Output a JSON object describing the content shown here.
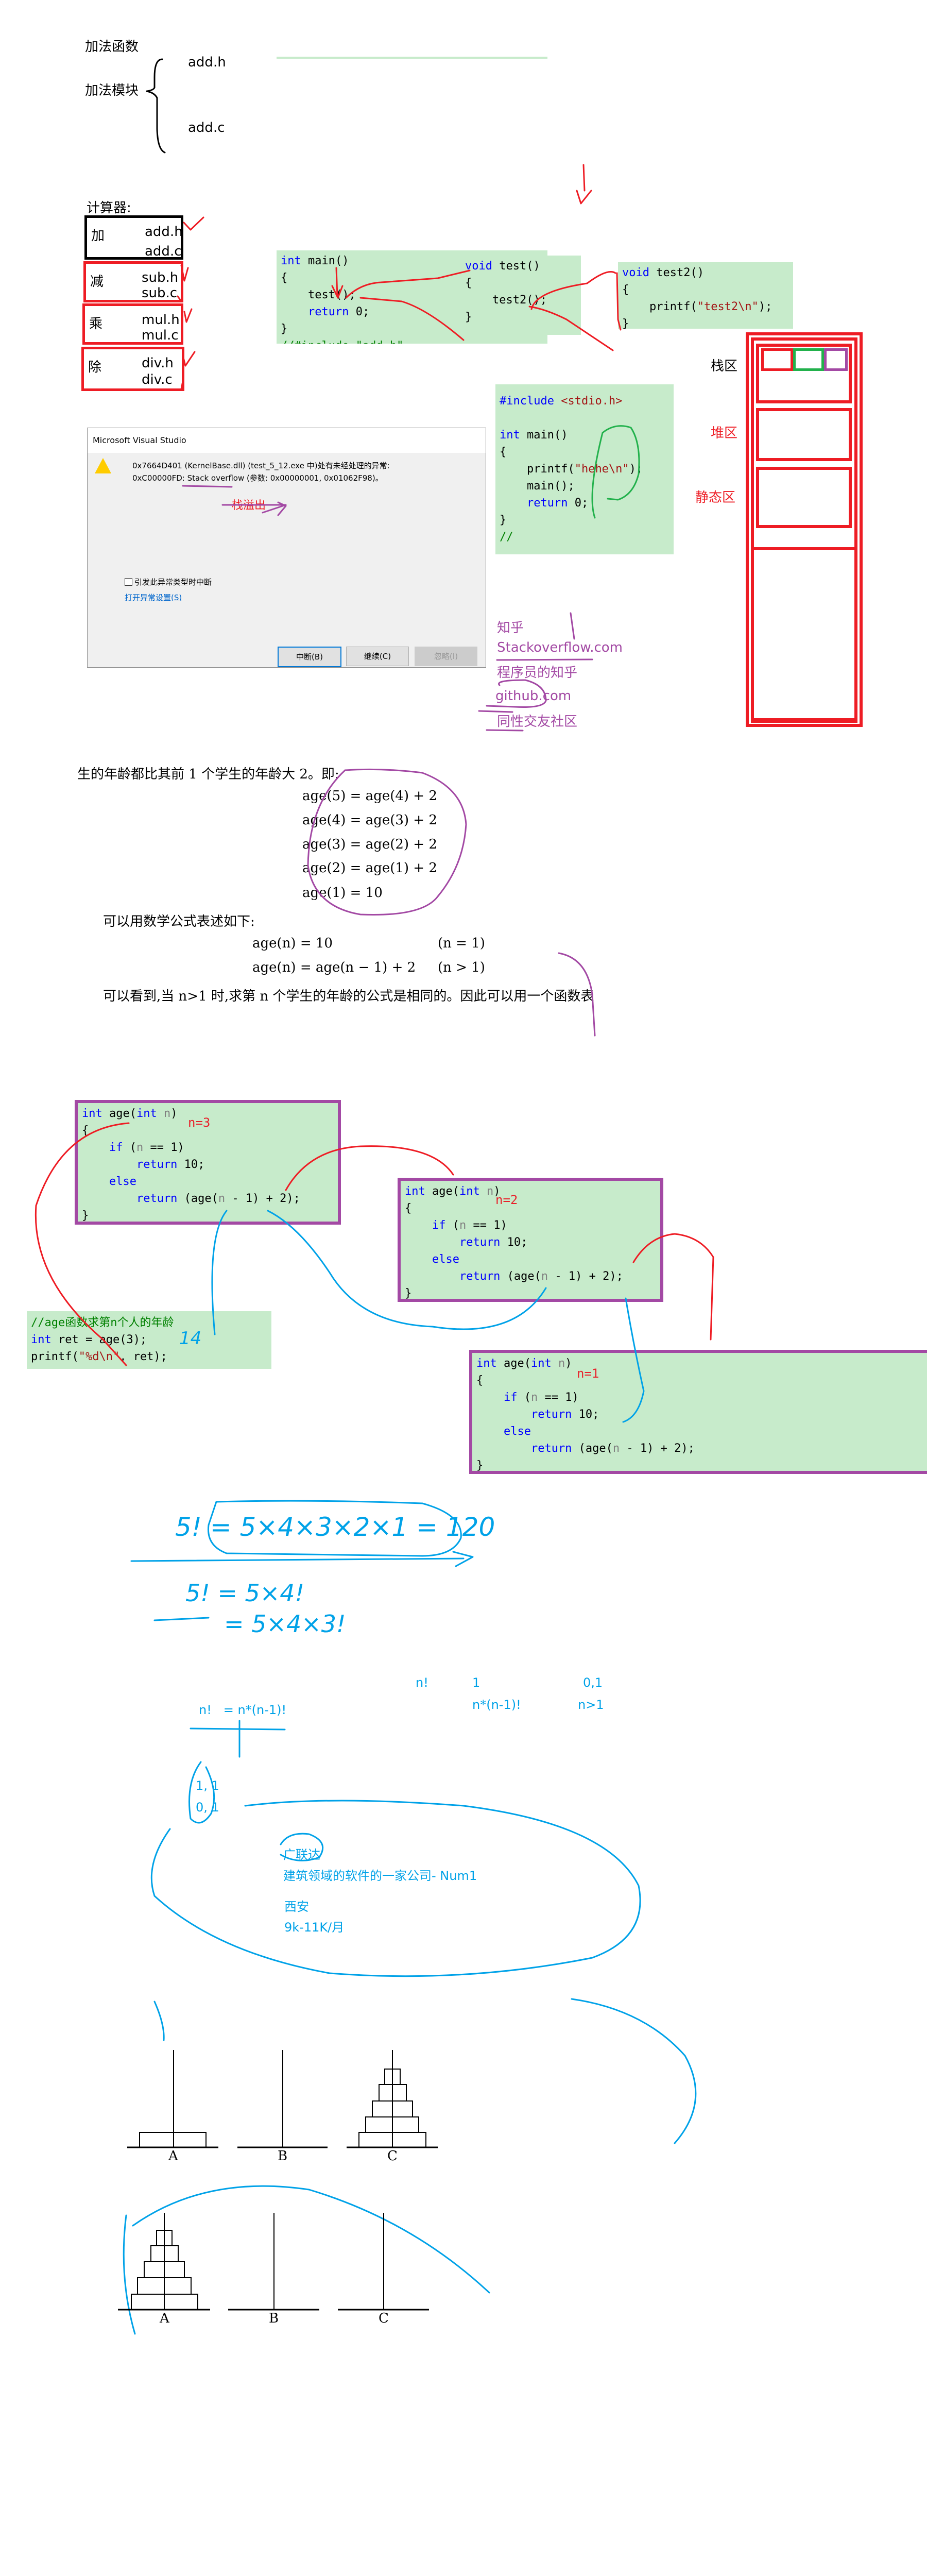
{
  "add_module": {
    "add_function": "加法函数",
    "add_module": "加法模块",
    "add_h": "add.h",
    "add_c": "add.c"
  },
  "calculator": {
    "title": "计算器:",
    "rows": [
      {
        "op": "加",
        "h": "add.h",
        "c": "add.c"
      },
      {
        "op": "减",
        "h": "sub.h",
        "c": "sub.c"
      },
      {
        "op": "乘",
        "h": "mul.h",
        "c": "mul.c"
      },
      {
        "op": "除",
        "h": "div.h",
        "c": "div.c"
      }
    ]
  },
  "code_blocks": {
    "main": [
      [
        [
          "k",
          "int"
        ],
        [
          "",
          " main()"
        ]
      ],
      [
        [
          "",
          "{"
        ]
      ],
      [
        [
          "",
          "    test();"
        ]
      ],
      [
        [
          "k",
          "    return"
        ],
        [
          "",
          " 0;"
        ]
      ],
      [
        [
          "",
          "}"
        ]
      ],
      [
        [
          "c",
          "//#include \"add.h\""
        ]
      ]
    ],
    "test": [
      [
        [
          "k",
          "void"
        ],
        [
          "",
          " test()"
        ]
      ],
      [
        [
          "",
          "{"
        ]
      ],
      [
        [
          "",
          "    test2();"
        ]
      ],
      [
        [
          "",
          "}"
        ]
      ]
    ],
    "test2": [
      [
        [
          "k",
          "void"
        ],
        [
          "",
          " test2()"
        ]
      ],
      [
        [
          "",
          "{"
        ]
      ],
      [
        [
          "",
          "    printf("
        ],
        [
          "s",
          "\"test2\\n\""
        ],
        [
          "",
          ");"
        ]
      ],
      [
        [
          "",
          "}"
        ]
      ]
    ],
    "include": [
      [
        [
          "k",
          "#include"
        ],
        [
          "s",
          " <stdio.h>"
        ]
      ],
      [
        [
          "",
          ""
        ]
      ],
      [
        [
          "k",
          "int"
        ],
        [
          "",
          " main()"
        ]
      ],
      [
        [
          "",
          "{"
        ]
      ],
      [
        [
          "",
          "    printf("
        ],
        [
          "s",
          "\"hehe\\n\""
        ],
        [
          "",
          ");"
        ]
      ],
      [
        [
          "",
          "    main();"
        ]
      ],
      [
        [
          "k",
          "    return"
        ],
        [
          "",
          " 0;"
        ]
      ],
      [
        [
          "",
          "}"
        ]
      ],
      [
        [
          "c",
          "//"
        ]
      ]
    ],
    "age": [
      [
        [
          "k",
          "int"
        ],
        [
          "",
          " age("
        ],
        [
          "k",
          "int"
        ],
        [
          "p",
          " n"
        ],
        [
          "",
          ")"
        ]
      ],
      [
        [
          "",
          "{"
        ]
      ],
      [
        [
          "k",
          "    if"
        ],
        [
          "",
          " ("
        ],
        [
          "p",
          "n"
        ],
        [
          "",
          " == 1)"
        ]
      ],
      [
        [
          "k",
          "        return"
        ],
        [
          "",
          " 10;"
        ]
      ],
      [
        [
          "k",
          "    else"
        ]
      ],
      [
        [
          "k",
          "        return"
        ],
        [
          "",
          " (age("
        ],
        [
          "p",
          "n"
        ],
        [
          "",
          " - 1) + 2);"
        ]
      ],
      [
        [
          "",
          "}"
        ]
      ]
    ],
    "snippet": [
      [
        [
          "c",
          "//age函数求第n个人的年龄"
        ]
      ],
      [
        [
          "k",
          "int"
        ],
        [
          "",
          " ret = age(3);"
        ]
      ],
      [
        [
          "",
          "printf("
        ],
        [
          "s",
          "\"%d\\n\""
        ],
        [
          "",
          ", ret);"
        ]
      ]
    ]
  },
  "age_calls": [
    "n=3",
    "n=2",
    "n=1"
  ],
  "memory": {
    "stack": "栈区",
    "heap": "堆区",
    "static": "静态区"
  },
  "dialog": {
    "title": "Microsoft Visual Studio",
    "line1": "0x7664D401 (KernelBase.dll) (test_5_12.exe 中)处有未经处理的异常:",
    "line2": "0xC00000FD: Stack overflow (参数: 0x00000001, 0x01062F98)。",
    "annotation": "栈溢出",
    "checkbox": "引发此异常类型时中断",
    "link": "打开异常设置(S)",
    "buttons": {
      "break": "中断(B)",
      "continue": "继续(C)",
      "ignore": "忽略(I)"
    }
  },
  "sites": [
    "知乎",
    "Stackoverflow.com",
    "程序员的知乎",
    "github.com",
    "同性交友社区"
  ],
  "textbook": {
    "intro": "生的年龄都比其前 1 个学生的年龄大 2。即:",
    "equations": [
      "age(5) = age(4) + 2",
      "age(4) = age(3) + 2",
      "age(3) = age(2) + 2",
      "age(2) = age(1) + 2",
      "age(1) = 10"
    ],
    "formula_intro": "可以用数学公式表述如下:",
    "formula1": "age(n) = 10",
    "cond1": "(n = 1)",
    "formula2": "age(n) = age(n − 1) + 2",
    "cond2": "(n > 1)",
    "conclusion": "可以看到,当 n>1 时,求第 n 个学生的年龄的公式是相同的。因此可以用一个函数表"
  },
  "handwritten": {
    "call_value": "14",
    "factorial_expand": "5! = 5×4×3×2×1 = 120",
    "factorial_rec1": "5! = 5×4!",
    "factorial_rec2": "= 5×4×3!"
  },
  "factorial": {
    "def_lhs": "n!",
    "case1": "1",
    "cond1": "0,1",
    "case2": "n*(n-1)!",
    "cond2": "n>1",
    "recurrence": "n!   = n*(n-1)!"
  },
  "fibonacci": {
    "line1": "1, 1",
    "line2": "0, 1"
  },
  "company": {
    "name": "广联达",
    "desc": "建筑领域的软件的一家公司- Num1",
    "city": "西安",
    "salary": "9k-11K/月"
  },
  "hanoi": {
    "pegs": [
      "A",
      "B",
      "C"
    ]
  }
}
